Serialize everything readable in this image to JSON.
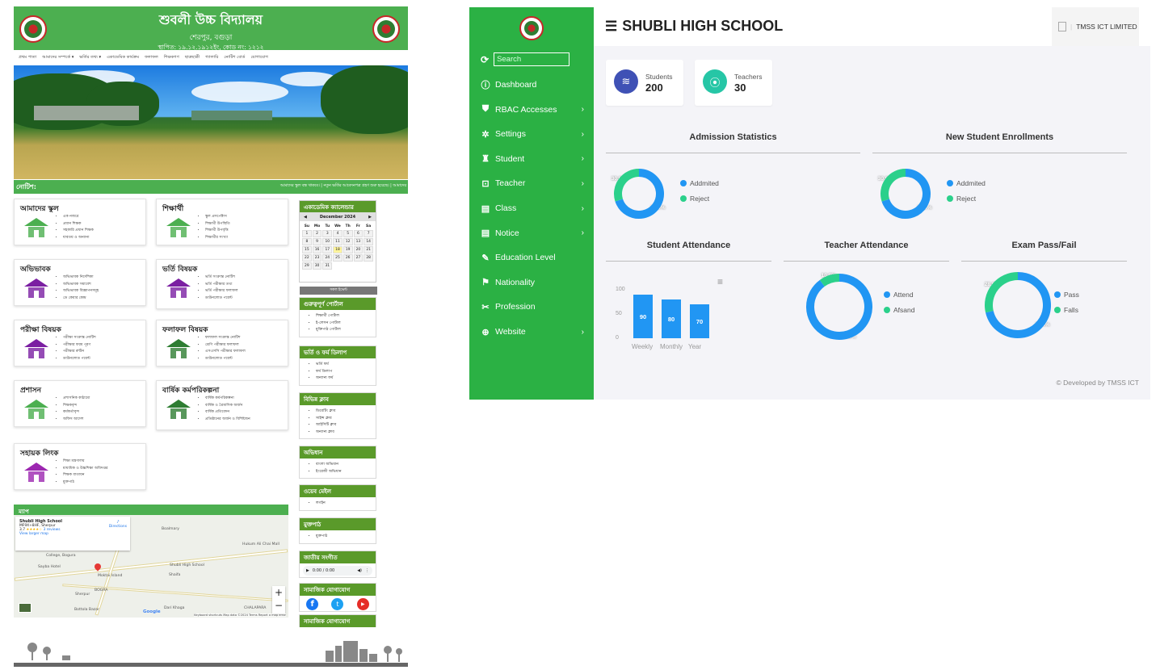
{
  "school_site": {
    "title": "শুবলী উচ্চ বিদ্যালয়",
    "location": "শেরপুর, বগুড়া",
    "established": "স্থাপিত: ১৯.১২.১৯১২ইং, কোড নং: ১২১২",
    "nav": [
      "প্রথম পাতা",
      "আমাদের সম্পর্কে ▾",
      "ভর্তির তথ্য ▾",
      "একাডেমিক কার্যক্রম",
      "ফলাফল",
      "শিক্ষকগণ",
      "ছাত্রছাত্রী",
      "গ্যালারি",
      "নোটিশ বোর্ড",
      "যোগাযোগ"
    ],
    "notice_label": "নোটিশ:",
    "notice_ticker": "আমাদের স্কুল বন্ধ থাকবে। | নতুন ভর্তির আবেদনপত্র গ্রহণ শুরু হয়েছে। | আমাদের",
    "cards": [
      {
        "title": "আমাদের স্কুল",
        "items": [
          "এক নজরে",
          "প্রধান শিক্ষক",
          "সহকারি প্রধান শিক্ষক",
          "যাবতয় ও অন্যান্য"
        ]
      },
      {
        "title": "শিক্ষার্থী",
        "items": [
          "স্কুল প্রসপেক্টাস",
          "শিক্ষার্থী উপস্থিতি",
          "শিক্ষার্থী উপবৃত্তি",
          "শিক্ষার্থীর সংখ্যা"
        ]
      },
      {
        "title": "অভিভাবক",
        "items": [
          "অভিভাবক নির্দেশিকা",
          "অভিভাবক সমাবেশ",
          "অভিভাবক বিজ্ঞাপনসমূহ",
          "ডে কেয়ার কেন্দ্র"
        ]
      },
      {
        "title": "ভর্তি বিষয়ক",
        "items": [
          "ভর্তি সংক্রান্ত নোটিশ",
          "ভর্তি পরীক্ষার তথ্য",
          "ভর্তি পরীক্ষার ফলাফল",
          "ডাউনলোড পয়েন্ট"
        ]
      },
      {
        "title": "পরীক্ষা বিষয়ক",
        "items": [
          "পরীক্ষা সংক্রান্ত নোটিশ",
          "পরীক্ষার ফরম পূরণ",
          "পরীক্ষার রুটিন",
          "ডাউনলোড পয়েন্ট"
        ]
      },
      {
        "title": "ফলাফল বিষয়ক",
        "items": [
          "ফলাফল সংক্রান্ত নোটিশ",
          "শ্রেণি পরীক্ষার ফলাফল",
          "এসএসসি পরীক্ষার ফলাফল",
          "ডাউনলোড পয়েন্ট"
        ]
      },
      {
        "title": "প্রশাসন",
        "items": [
          "প্রশাসনিক কাঠামো",
          "শিক্ষকবৃন্দ",
          "কর্মকর্তাবৃন্দ",
          "অফিস আদেশ"
        ]
      },
      {
        "title": "বার্ষিক কর্মপরিকল্পনা",
        "items": [
          "বার্ষিক কর্মপরিকল্পনা",
          "বার্ষিক ও ত্রৈমাসিক অর্জন",
          "বার্ষিক প্রতিবেদন",
          "প্রতিষ্ঠানের অর্জন ও বিশিষ্টজন"
        ]
      },
      {
        "title": "সহায়ক লিংক",
        "items": [
          "শিক্ষা মন্ত্রণালয়",
          "মাধ্যমিক ও উচ্চশিক্ষা অধিদপ্তর",
          "শিক্ষক বাতায়ন",
          "মুক্তপাঠ"
        ]
      }
    ],
    "calendar": {
      "title": "একাডেমিক ক্যালেন্ডার",
      "month": "December 2024",
      "days": [
        "Su",
        "Mo",
        "Tu",
        "We",
        "Th",
        "Fr",
        "Sa"
      ],
      "weeks": [
        [
          "1",
          "2",
          "3",
          "4",
          "5",
          "6",
          "7"
        ],
        [
          "8",
          "9",
          "10",
          "11",
          "12",
          "13",
          "14"
        ],
        [
          "15",
          "16",
          "17",
          "18",
          "19",
          "20",
          "21"
        ],
        [
          "22",
          "23",
          "24",
          "25",
          "26",
          "27",
          "28"
        ],
        [
          "29",
          "30",
          "31",
          "",
          "",
          "",
          ""
        ]
      ],
      "today": "18",
      "all_events": "সকল ইভেন্ট"
    },
    "side_boxes": [
      {
        "title": "গুরুত্বপূর্ণ পোর্টাল",
        "items": [
          "শিক্ষার্থী পোর্টাল",
          "ই-লেসন পোর্টাল",
          "মুক্তিপাঠ পোর্টাল"
        ]
      },
      {
        "title": "ভর্তি ও ফর্ম ডিলাপ",
        "items": [
          "ভর্তি ফর্ম",
          "ফর্ম ডিলাপ",
          "অন্যান্য ফর্ম"
        ]
      },
      {
        "title": "বিভিন্ন ক্লাব",
        "items": [
          "ডিবেটিং ক্লাব",
          "সাইন্স ক্লাব",
          "আইসিটি ক্লাব",
          "অন্যান্য ক্লাব"
        ]
      },
      {
        "title": "অভিধান",
        "items": [
          "বাংলা অভিধান",
          "ইংরেজী অভিধান"
        ]
      },
      {
        "title": "ওয়েব মেইল",
        "items": [
          "লগইন"
        ]
      },
      {
        "title": "মুক্তপাঠ",
        "items": [
          "মুক্তপাঠ"
        ]
      }
    ],
    "anthem": {
      "title": "জাতীয় সংগীত",
      "time": "0:00 / 0:00"
    },
    "social": {
      "title": "সামাজিক যোগাযোগ",
      "title2": "সামাজিক যোগাযোগ"
    },
    "map": {
      "title": "ম্যাপ",
      "place_name": "Shubli High School",
      "place_addr": "MF9X+8HF, Sherpur",
      "rating": "3.7",
      "reviews": "3 reviews",
      "larger": "View larger map",
      "directions": "Directions",
      "labels": [
        "Boalmary",
        "Shubli High School",
        "Shaifa",
        "Sherpur",
        "Hukum Ali Chai Mall",
        "Moktai Island",
        "Sayba Hotel",
        "Dari Khaga",
        "CHALAPARA",
        "Bottola Bazar",
        "BOGRA",
        "College, Bogura"
      ],
      "footer": "Keyboard shortcuts   Map data ©2024   Terms   Report a map error",
      "google": "Google"
    }
  },
  "dashboard": {
    "title": "SHUBLI HIGH SCHOOL",
    "org": "TMSS ICT LIMITED",
    "search_placeholder": "Search",
    "menu": [
      {
        "label": "Dashboard",
        "icon": "info-icon",
        "chevron": false
      },
      {
        "label": "RBAC Accesses",
        "icon": "shield-icon",
        "chevron": true
      },
      {
        "label": "Settings",
        "icon": "gear-icon",
        "chevron": true
      },
      {
        "label": "Student",
        "icon": "student-icon",
        "chevron": true
      },
      {
        "label": "Teacher",
        "icon": "teacher-icon",
        "chevron": true
      },
      {
        "label": "Class",
        "icon": "book-icon",
        "chevron": true
      },
      {
        "label": "Notice",
        "icon": "notice-icon",
        "chevron": true
      },
      {
        "label": "Education Level",
        "icon": "pencil-icon",
        "chevron": false
      },
      {
        "label": "Nationality",
        "icon": "flag-icon",
        "chevron": false
      },
      {
        "label": "Profession",
        "icon": "wrench-icon",
        "chevron": false
      },
      {
        "label": "Website",
        "icon": "globe-icon",
        "chevron": true
      }
    ],
    "stats": [
      {
        "label": "Students",
        "value": "200",
        "color": "#3f51b5"
      },
      {
        "label": "Teachers",
        "value": "30",
        "color": "#26c6a6"
      }
    ],
    "footer": "© Developed by TMSS ICT",
    "colors": {
      "blue": "#2196f3",
      "green": "#2bd08b",
      "sidebar": "#2bb144"
    }
  },
  "chart_data": [
    {
      "type": "pie",
      "title": "Admission Statistics",
      "labels": [
        "Addmited",
        "Reject"
      ],
      "values": [
        70,
        30
      ],
      "data_labels": [
        "70.0%",
        "30.0%"
      ]
    },
    {
      "type": "pie",
      "title": "New Student Enrollments",
      "labels": [
        "Addmited",
        "Reject"
      ],
      "values": [
        70,
        30
      ],
      "data_labels": [
        "70.0%",
        "30.0%"
      ]
    },
    {
      "type": "bar",
      "title": "Student Attendance",
      "categories": [
        "Weekly",
        "Monthly",
        "Year"
      ],
      "values": [
        90,
        80,
        70
      ],
      "ylim": [
        0,
        100
      ],
      "yticks": [
        "0",
        "50",
        "100"
      ]
    },
    {
      "type": "pie",
      "title": "Teacher Attendance",
      "labels": [
        "Attend",
        "Afsand"
      ],
      "values": [
        90,
        10
      ],
      "data_labels": [
        "90.0%",
        "10.0%"
      ]
    },
    {
      "type": "pie",
      "title": "Exam Pass/Fail",
      "labels": [
        "Pass",
        "Falls"
      ],
      "values": [
        71.4,
        28.6
      ],
      "data_labels": [
        "71.4%",
        "28.6%"
      ]
    }
  ]
}
